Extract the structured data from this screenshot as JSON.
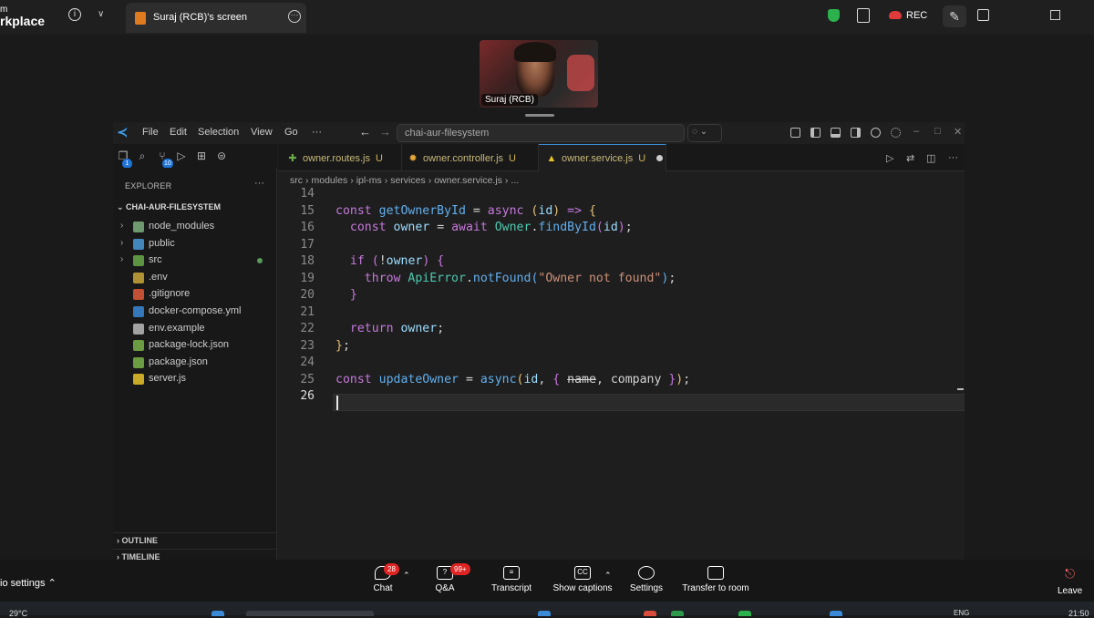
{
  "zoom": {
    "app_title_line1": "m",
    "app_title_line2": "rkplace",
    "screen_tab_label": "Suraj (RCB)'s screen",
    "rec_label": "REC",
    "participant_name": "Suraj (RCB)",
    "bottom": {
      "audio_settings": "io settings",
      "chat_label": "Chat",
      "chat_badge": "28",
      "qa_label": "Q&A",
      "qa_badge": "99+",
      "transcript_label": "Transcript",
      "captions_label": "Show captions",
      "settings_label": "Settings",
      "transfer_label": "Transfer to room",
      "leave_label": "Leave"
    }
  },
  "taskbar": {
    "temp": "29°C",
    "lang": "ENG",
    "time": "21:50"
  },
  "vscode": {
    "menu": [
      "File",
      "Edit",
      "Selection",
      "View",
      "Go",
      "···"
    ],
    "command_center": "chai-aur-filesystem",
    "explorer_title": "EXPLORER",
    "explorer_more": "···",
    "workspace": "CHAI-AUR-FILESYSTEM",
    "activity_badges": {
      "explorer": "1",
      "scm": "10"
    },
    "tree": [
      {
        "name": "node_modules",
        "twisty": "›",
        "icon": "folder-icon",
        "color": "#7fb07f"
      },
      {
        "name": "public",
        "twisty": "›",
        "icon": "folder-icon",
        "color": "#4a9ad8"
      },
      {
        "name": "src",
        "twisty": "›",
        "icon": "folder-icon",
        "color": "#6aaa4a"
      },
      {
        "name": ".env",
        "twisty": "",
        "icon": "env-icon",
        "color": "#c9a83a"
      },
      {
        "name": ".gitignore",
        "twisty": "",
        "icon": "git-icon",
        "color": "#e05a3a"
      },
      {
        "name": "docker-compose.yml",
        "twisty": "",
        "icon": "docker-icon",
        "color": "#3a8ad8"
      },
      {
        "name": "env.example",
        "twisty": "",
        "icon": "file-icon",
        "color": "#bbbbbb"
      },
      {
        "name": "package-lock.json",
        "twisty": "",
        "icon": "node-icon",
        "color": "#7ab44a"
      },
      {
        "name": "package.json",
        "twisty": "",
        "icon": "node-icon",
        "color": "#7ab44a"
      },
      {
        "name": "server.js",
        "twisty": "",
        "icon": "js-icon",
        "color": "#e8c42a"
      }
    ],
    "outline": "OUTLINE",
    "timeline": "TIMELINE",
    "tabs": [
      {
        "label": "owner.routes.js",
        "status": "U",
        "icon_color": "#6aaa4a"
      },
      {
        "label": "owner.controller.js",
        "status": "U",
        "icon_color": "#e8a83a"
      },
      {
        "label": "owner.service.js",
        "status": "U",
        "icon_color": "#e8c42a"
      }
    ],
    "breadcrumb": [
      "src",
      "›",
      "modules",
      "›",
      "ipl-ms",
      "›",
      "services",
      "›",
      "owner.service.js",
      "›",
      "..."
    ],
    "line_numbers": [
      "14",
      "15",
      "16",
      "17",
      "18",
      "19",
      "20",
      "21",
      "22",
      "23",
      "24",
      "25",
      "26"
    ],
    "current_line": "26"
  }
}
